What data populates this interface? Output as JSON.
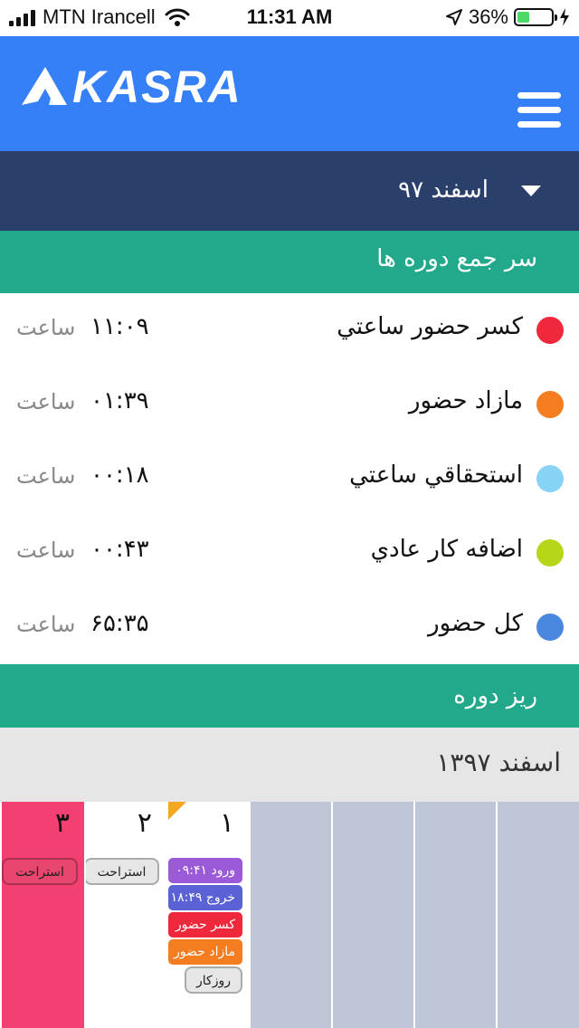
{
  "status_bar": {
    "carrier": "MTN Irancell",
    "time": "11:31 AM",
    "battery": "36%",
    "battery_level": 0.36
  },
  "header": {
    "logo_text": "KASRA"
  },
  "period_selector": {
    "label": "اسفند ۹۷"
  },
  "summary": {
    "title": "سر جمع دوره ها",
    "rows": [
      {
        "label": "كسر حضور ساعتي",
        "value": "۱۱:۰۹",
        "unit": "ساعت",
        "color": "#f0283c"
      },
      {
        "label": "مازاد حضور",
        "value": "۰۱:۳۹",
        "unit": "ساعت",
        "color": "#f57c1f"
      },
      {
        "label": "استحقاقي ساعتي",
        "value": "۰۰:۱۸",
        "unit": "ساعت",
        "color": "#87d3f5"
      },
      {
        "label": "اضافه كار عادي",
        "value": "۰۰:۴۳",
        "unit": "ساعت",
        "color": "#b5d718"
      },
      {
        "label": "كل حضور",
        "value": "۶۵:۳۵",
        "unit": "ساعت",
        "color": "#4a88e0"
      }
    ]
  },
  "details": {
    "title": "ريز دوره",
    "month_title": "اسفند ۱۳۹۷"
  },
  "calendar": {
    "days": [
      {
        "num": "۱",
        "rest": "روزكار",
        "pills": [
          {
            "text": "ورود ۰۹:۴۱",
            "color": "#9b5ad8"
          },
          {
            "text": "خروج ۱۸:۴۹",
            "color": "#5b62d6"
          },
          {
            "text": "كسر حضور",
            "color": "#f0283c"
          },
          {
            "text": "مازاد حضور",
            "color": "#f57c1f"
          }
        ]
      },
      {
        "num": "۲",
        "rest": "استراحت",
        "bg": "#ffffff"
      },
      {
        "num": "۳",
        "rest": "استراحت",
        "bg": "#f43f72"
      }
    ]
  },
  "colors": {
    "header": "#3680f7",
    "period_bar": "#2a3f6a",
    "section": "#22a88a",
    "empty_cell": "#bfc7d6"
  }
}
